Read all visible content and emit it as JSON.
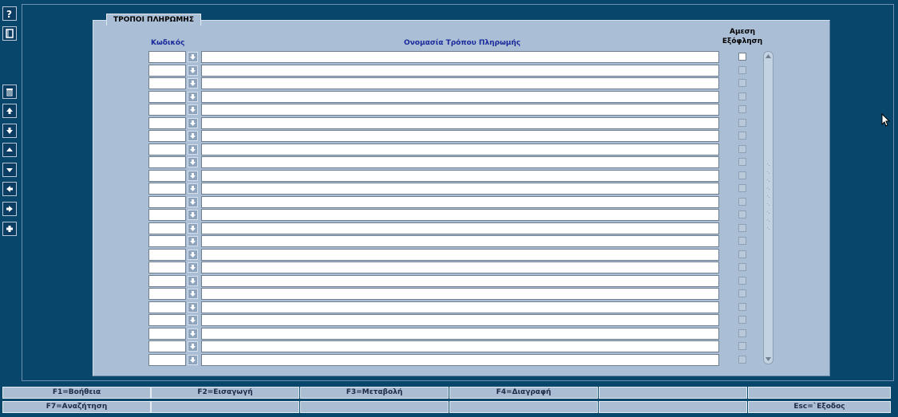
{
  "panel": {
    "tab_title": "ΤΡΟΠΟΙ ΠΛΗΡΩΜΗΣ",
    "col_code": "Κωδικός",
    "col_name": "Ονομασία Τρόπου Πληρωμής",
    "col_direct_line1": "Αμεση",
    "col_direct_line2": "Εξόφληση"
  },
  "toolbar": {
    "icons": [
      "help-icon",
      "book-icon",
      "trash-icon",
      "first-record-icon",
      "last-record-icon",
      "prev-block-icon",
      "next-block-icon",
      "prev-record-icon",
      "next-record-icon",
      "add-icon"
    ]
  },
  "rows": [
    {
      "code": "",
      "name": "",
      "direct": false
    },
    {
      "code": "",
      "name": "",
      "direct": false
    },
    {
      "code": "",
      "name": "",
      "direct": false
    },
    {
      "code": "",
      "name": "",
      "direct": false
    },
    {
      "code": "",
      "name": "",
      "direct": false
    },
    {
      "code": "",
      "name": "",
      "direct": false
    },
    {
      "code": "",
      "name": "",
      "direct": false
    },
    {
      "code": "",
      "name": "",
      "direct": false
    },
    {
      "code": "",
      "name": "",
      "direct": false
    },
    {
      "code": "",
      "name": "",
      "direct": false
    },
    {
      "code": "",
      "name": "",
      "direct": false
    },
    {
      "code": "",
      "name": "",
      "direct": false
    },
    {
      "code": "",
      "name": "",
      "direct": false
    },
    {
      "code": "",
      "name": "",
      "direct": false
    },
    {
      "code": "",
      "name": "",
      "direct": false
    },
    {
      "code": "",
      "name": "",
      "direct": false
    },
    {
      "code": "",
      "name": "",
      "direct": false
    },
    {
      "code": "",
      "name": "",
      "direct": false
    },
    {
      "code": "",
      "name": "",
      "direct": false
    },
    {
      "code": "",
      "name": "",
      "direct": false
    },
    {
      "code": "",
      "name": "",
      "direct": false
    },
    {
      "code": "",
      "name": "",
      "direct": false
    },
    {
      "code": "",
      "name": "",
      "direct": false
    },
    {
      "code": "",
      "name": "",
      "direct": false
    }
  ],
  "function_keys": {
    "row1": [
      "F1=Βοήθεια",
      "F2=Εισαγωγή",
      "F3=Μεταβολή",
      "F4=Διαγραφή",
      "",
      ""
    ],
    "row2": [
      "F7=Αναζήτηση",
      "",
      "",
      "",
      "",
      "Esc=`Εξοδος"
    ]
  },
  "colors": {
    "background": "#08466c",
    "panel": "#aabfd6",
    "header_text": "#1b2a9a"
  }
}
